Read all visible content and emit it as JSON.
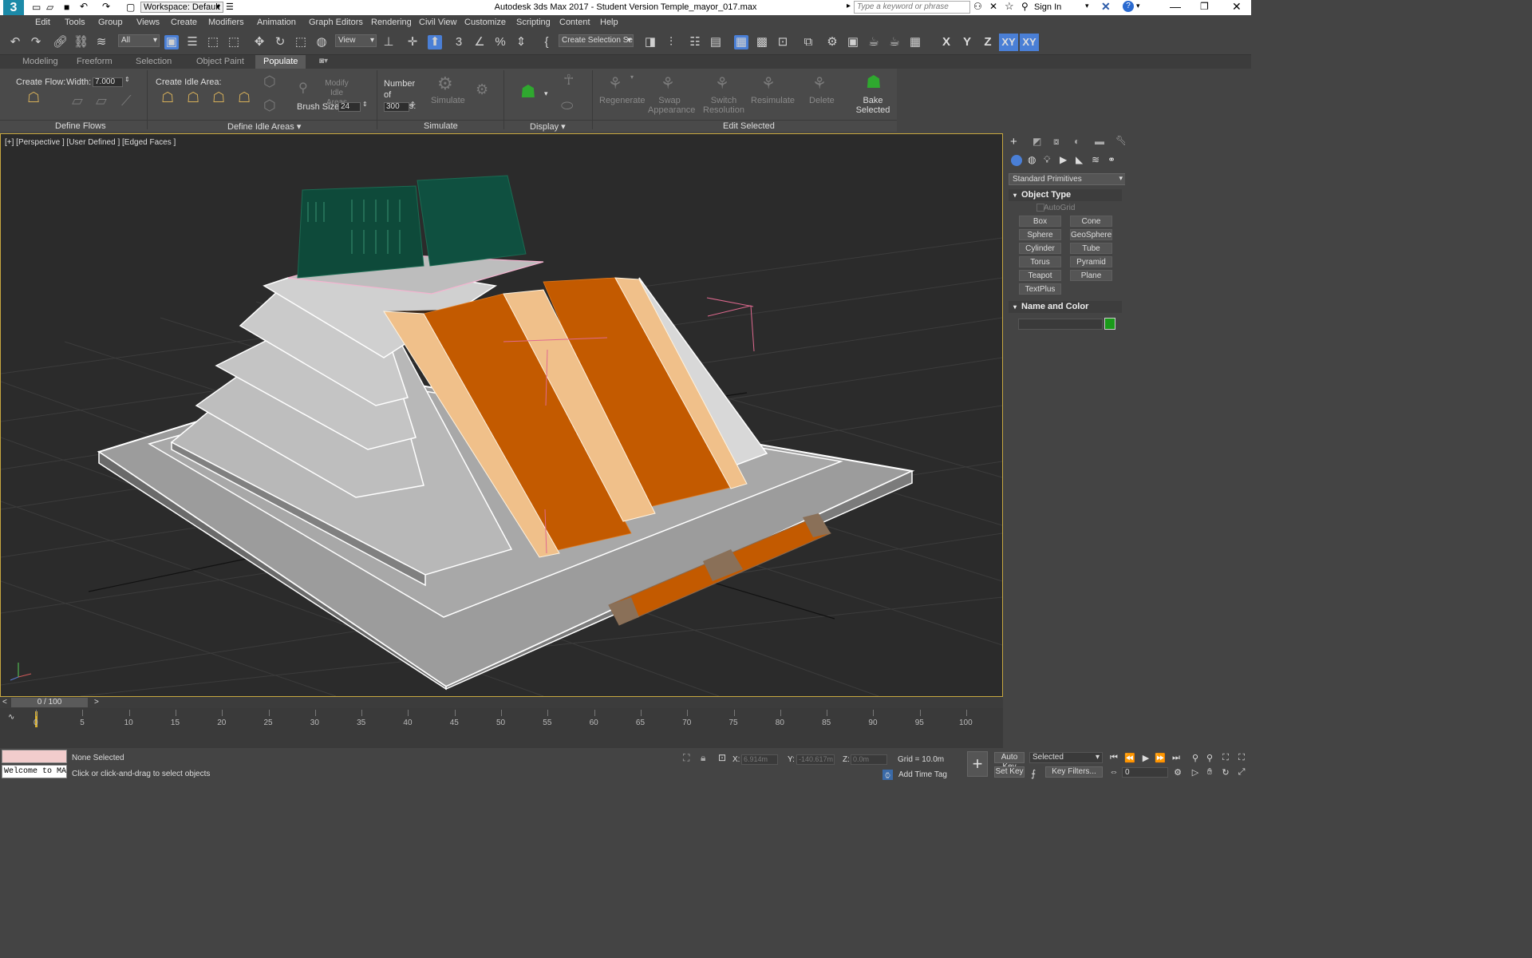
{
  "app": {
    "title": "Autodesk 3ds Max 2017 - Student Version    Temple_mayor_017.max",
    "logo": "3",
    "workspace": "Workspace: Default",
    "search_placeholder": "Type a keyword or phrase",
    "sign_in": "Sign In"
  },
  "menu": [
    "Edit",
    "Tools",
    "Group",
    "Views",
    "Create",
    "Modifiers",
    "Animation",
    "Graph Editors",
    "Rendering",
    "Civil View",
    "Customize",
    "Scripting",
    "Content",
    "Help"
  ],
  "toolbar": {
    "selection_filter": "All",
    "ref_coord": "View",
    "named_selection": "Create Selection Se",
    "axis": [
      "X",
      "Y",
      "Z",
      "XY",
      "XY"
    ]
  },
  "ribbon_tabs": [
    "Modeling",
    "Freeform",
    "Selection",
    "Object Paint",
    "Populate"
  ],
  "ribbon": {
    "create_flow_label": "Create Flow:",
    "width_label": "Width:",
    "width_value": "7.000",
    "define_flows": "Define Flows",
    "create_idle_label": "Create Idle Area:",
    "modify_idle": "Modify Idle Areas",
    "brush_label": "Brush Size:",
    "brush_value": "24",
    "define_idle": "Define Idle Areas",
    "frames_label": "Number of Frames:",
    "frames_value": "300",
    "simulate_btn": "Simulate",
    "simulate_group": "Simulate",
    "display_group": "Display",
    "regenerate": "Regenerate",
    "swap": "Swap Appearance",
    "switch": "Switch Resolution",
    "resimulate": "Resimulate",
    "delete": "Delete",
    "bake": "Bake Selected",
    "edit_selected": "Edit Selected"
  },
  "viewport": {
    "label": "[+] [Perspective ] [User Defined ] [Edged Faces ]"
  },
  "command_panel": {
    "category": "Standard Primitives",
    "object_type": "Object Type",
    "autogrid": "AutoGrid",
    "buttons": [
      "Box",
      "Cone",
      "Sphere",
      "GeoSphere",
      "Cylinder",
      "Tube",
      "Torus",
      "Pyramid",
      "Teapot",
      "Plane",
      "TextPlus"
    ],
    "name_color": "Name and Color",
    "object_color": "#1a9a1a"
  },
  "timeline": {
    "position": "0 / 100",
    "ticks": [
      "0",
      "5",
      "10",
      "15",
      "20",
      "25",
      "30",
      "35",
      "40",
      "45",
      "50",
      "55",
      "60",
      "65",
      "70",
      "75",
      "80",
      "85",
      "90",
      "95",
      "100"
    ]
  },
  "status": {
    "maxscript": "Welcome to MA",
    "selection": "None Selected",
    "prompt": "Click or click-and-drag to select objects",
    "x_label": "X:",
    "x_value": "6.914m",
    "y_label": "Y:",
    "y_value": "-140.617m",
    "z_label": "Z:",
    "z_value": "0.0m",
    "grid": "Grid = 10.0m",
    "add_time_tag": "Add Time Tag",
    "auto_key": "Auto Key",
    "set_key": "Set Key",
    "key_mode": "Selected",
    "key_filters": "Key Filters...",
    "frame": "0"
  },
  "colors": {
    "accent": "#4a7fd6",
    "viewport_border": "#c8a840",
    "stair_orange": "#c35a00",
    "temple_green": "#0e4a3a"
  }
}
